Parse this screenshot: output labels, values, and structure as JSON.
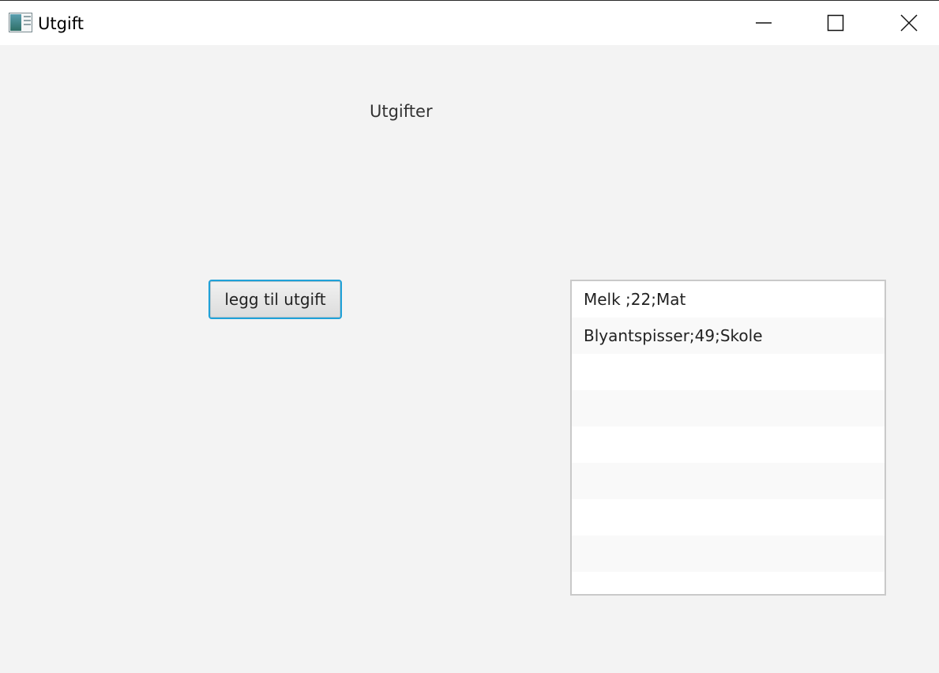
{
  "window": {
    "title": "Utgift",
    "app_icon": "app-window-icon",
    "controls": {
      "minimize_icon": "minimize-icon",
      "maximize_icon": "maximize-icon",
      "close_icon": "close-icon"
    }
  },
  "main": {
    "heading": "Utgifter",
    "add_button_label": "legg til utgift",
    "expense_list": {
      "items": [
        "Melk ;22;Mat",
        "Blyantspisser;49;Skole",
        "",
        "",
        "",
        "",
        "",
        "",
        ""
      ]
    }
  },
  "colors": {
    "background": "#f3f3f3",
    "focus_border": "#1fa1d8",
    "list_border": "#c9c9c9",
    "list_alt_row": "#f9f9f9"
  }
}
